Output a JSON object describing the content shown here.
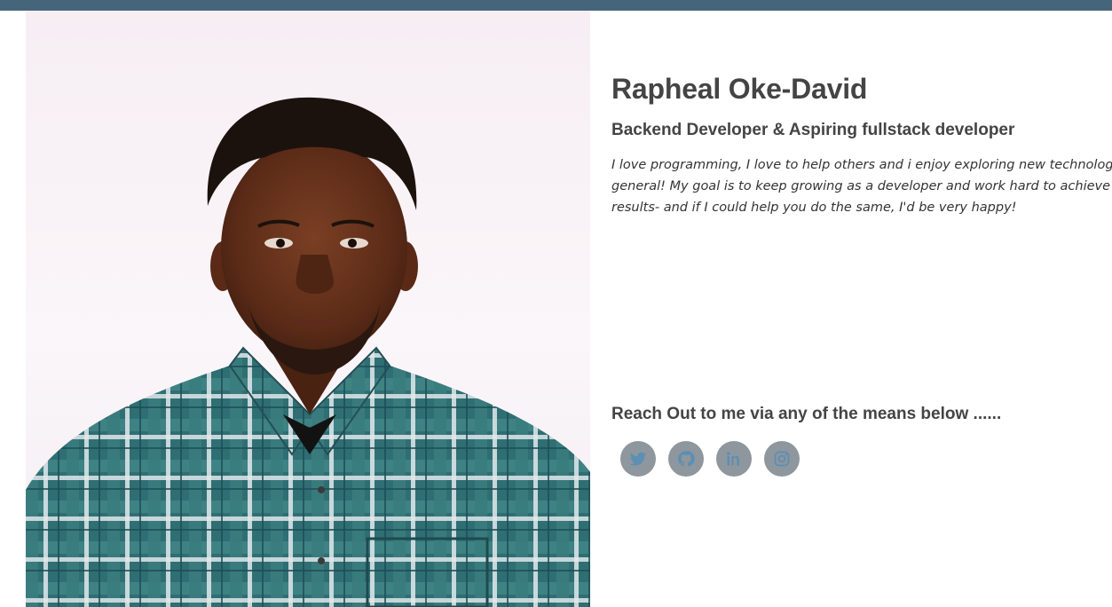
{
  "profile": {
    "name": "Rapheal Oke-David",
    "role": "Backend Developer & Aspiring fullstack developer",
    "bio_lines": [
      "I love programming, I love to help others and i enjoy exploring new technologies in",
      "general! My goal is to keep growing as a developer and work hard to achieve the best",
      "results- and if I could help you do the same, I'd be very happy!"
    ],
    "photo_icon": "profile-photo"
  },
  "contact": {
    "heading": "Reach Out to me via any of the means below ......",
    "links": [
      {
        "icon": "twitter-icon"
      },
      {
        "icon": "github-icon"
      },
      {
        "icon": "linkedin-icon"
      },
      {
        "icon": "instagram-icon"
      }
    ]
  },
  "colors": {
    "topbar": "#45657a",
    "social_bg": "#8e979d",
    "social_icon": "#5b8fb3",
    "text": "#444444"
  }
}
